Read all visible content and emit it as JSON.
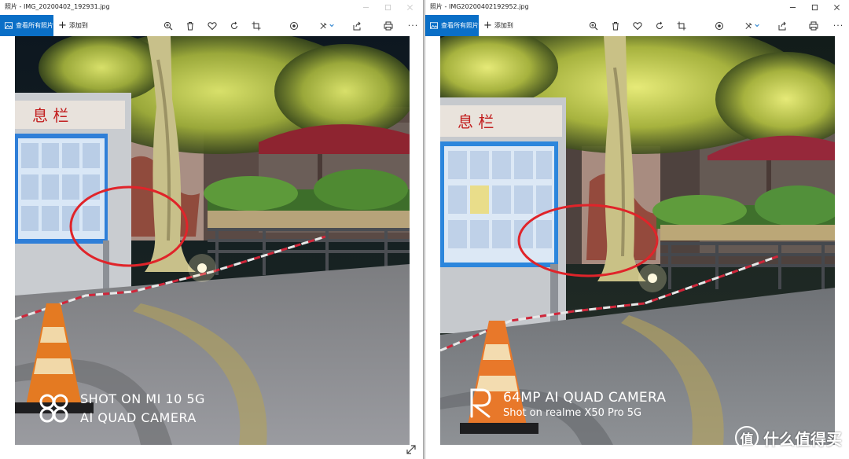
{
  "left_window": {
    "title": "照片 - IMG_20200402_192931.jpg",
    "view_all_label": "查看所有照片",
    "add_to_label": "添加到",
    "watermark_line1": "SHOT ON MI 10 5G",
    "watermark_line2": "AI QUAD CAMERA"
  },
  "right_window": {
    "title": "照片 - IMG20200402192952.jpg",
    "view_all_label": "查看所有照片",
    "add_to_label": "添加到",
    "watermark_line1": "64MP AI QUAD CAMERA",
    "watermark_line2": "Shot on realme X50 Pro 5G"
  },
  "board_sign_text": "息  栏",
  "site_badge": {
    "logo_char": "值",
    "text": "什么值得买"
  },
  "colors": {
    "accent_blue": "#0a6fc7",
    "annotation_red": "#e0242a"
  },
  "icons": [
    "view-all-icon",
    "zoom-icon",
    "delete-icon",
    "favorite-icon",
    "rotate-icon",
    "crop-icon",
    "enhance-icon",
    "edit-icon",
    "share-icon",
    "print-icon",
    "more-icon",
    "expand-icon"
  ]
}
